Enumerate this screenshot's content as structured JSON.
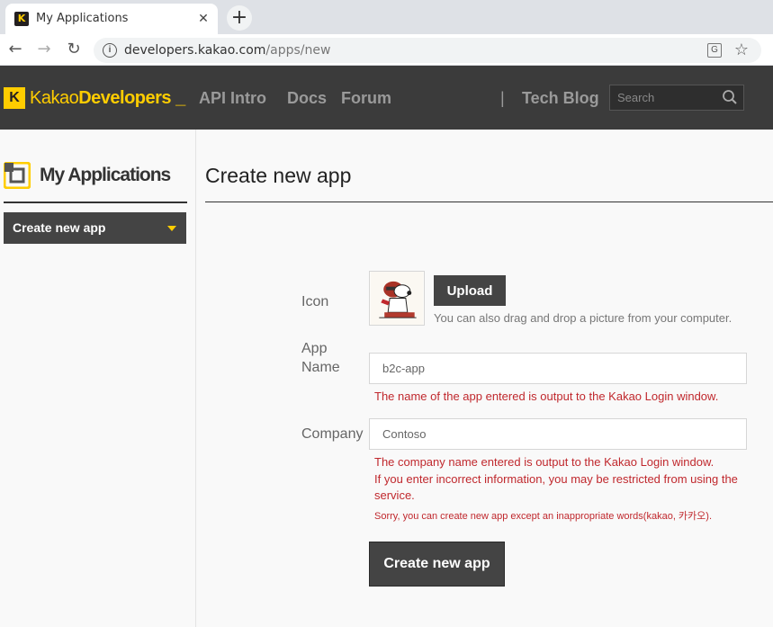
{
  "browser": {
    "tab_title": "My Applications",
    "favicon_text": "K",
    "tab_close": "✕",
    "new_tab": "+",
    "url_host": "developers.kakao.com",
    "url_path": "/apps/new"
  },
  "header": {
    "logo_badge": "K",
    "logo_light": "Kakao",
    "logo_bold": "Developers",
    "logo_cursor": "_",
    "nav": [
      "API Intro",
      "Docs",
      "Forum"
    ],
    "separator": "|",
    "tech_blog": "Tech Blog",
    "search_placeholder": "Search",
    "brand_color": "#ffcd00"
  },
  "sidebar": {
    "title": "My Applications",
    "menu_item": "Create new app"
  },
  "main": {
    "title": "Create new app",
    "icon_label": "Icon",
    "upload_label": "Upload",
    "upload_hint": "You can also drag and drop a picture from your computer.",
    "app_name_label_line1": "App",
    "app_name_label_line2": "Name",
    "app_name_value": "b2c-app",
    "app_name_note": "The name of the app entered is output to the Kakao Login window.",
    "company_label": "Company",
    "company_value": "Contoso",
    "company_note1": "The company name entered is output to the Kakao Login window.",
    "company_note2": "If you enter incorrect information, you may be restricted from using the service.",
    "company_note3": "Sorry, you can create new app except an inappropriate words(kakao, 카카오).",
    "submit_label": "Create new app",
    "error_color": "#c0282d"
  }
}
